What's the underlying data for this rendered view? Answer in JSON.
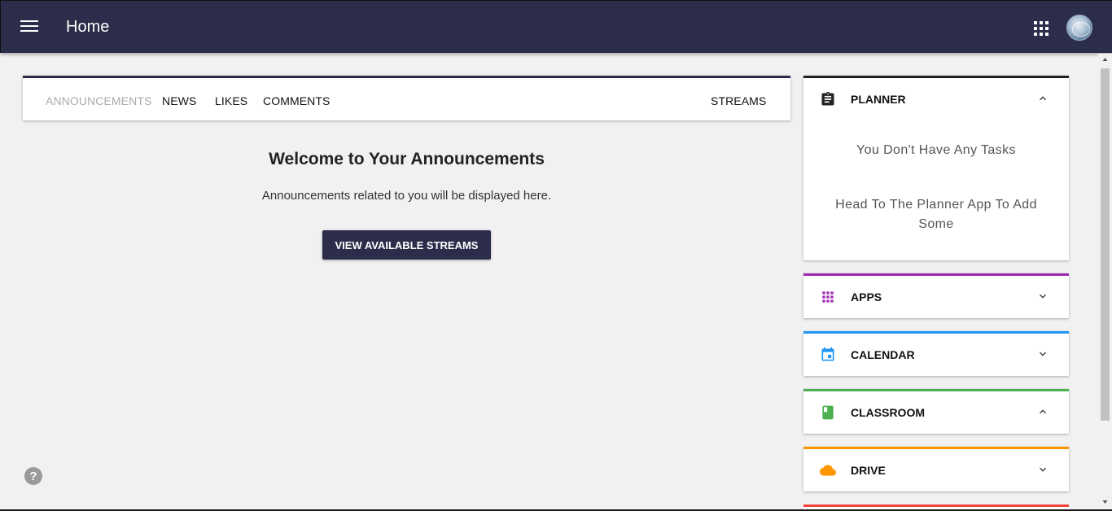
{
  "header": {
    "title": "Home",
    "menu_icon": "menu-icon",
    "apps_icon": "apps-grid-icon",
    "avatar_icon": "user-avatar",
    "bg_color": "#2c2c4b"
  },
  "tabs": {
    "items": [
      {
        "label": "ANNOUNCEMENTS",
        "active": true
      },
      {
        "label": "NEWS",
        "active": false
      },
      {
        "label": "LIKES",
        "active": false
      },
      {
        "label": "COMMENTS",
        "active": false
      }
    ],
    "streams_label": "STREAMS"
  },
  "main": {
    "title": "Welcome to Your Announcements",
    "subtitle": "Announcements related to you will be displayed here.",
    "button_label": "VIEW AVAILABLE STREAMS"
  },
  "help": {
    "label": "?",
    "icon": "help-icon"
  },
  "widgets": {
    "planner": {
      "title": "PLANNER",
      "color": "#222222",
      "icon": "clipboard-icon",
      "expanded": true,
      "empty_text": "You Don't Have Any Tasks",
      "hint_text": "Head To The Planner App To Add Some"
    },
    "apps": {
      "title": "APPS",
      "color": "#9c27b0",
      "icon": "apps-grid-icon",
      "expanded": false
    },
    "calendar": {
      "title": "CALENDAR",
      "color": "#2196f3",
      "icon": "calendar-icon",
      "expanded": false
    },
    "classroom": {
      "title": "CLASSROOM",
      "color": "#4caf50",
      "icon": "classroom-book-icon",
      "expanded": true
    },
    "drive": {
      "title": "DRIVE",
      "color": "#ff9800",
      "icon": "cloud-icon",
      "expanded": false
    },
    "next_color": "#f44336"
  }
}
